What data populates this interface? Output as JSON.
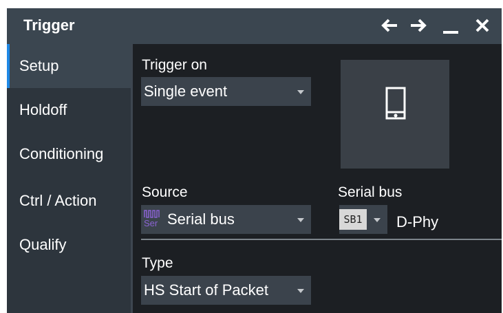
{
  "dialog": {
    "title": "Trigger",
    "titlebar_icons": [
      "arrow-left-icon",
      "arrow-right-icon",
      "minimize-icon",
      "close-icon"
    ],
    "accent_color": "#1e88e5"
  },
  "sidebar": {
    "items": [
      {
        "label": "Setup",
        "active": true
      },
      {
        "label": "Holdoff",
        "active": false
      },
      {
        "label": "Conditioning",
        "active": false
      },
      {
        "label": "Ctrl / Action",
        "active": false
      },
      {
        "label": "Qualify",
        "active": false
      }
    ]
  },
  "main": {
    "trigger_on": {
      "label": "Trigger on",
      "value": "Single event"
    },
    "source": {
      "label": "Source",
      "value": "Serial bus",
      "icon_text": "Ser",
      "icon": "serial-bus-icon"
    },
    "serial_bus": {
      "label": "Serial bus",
      "badge": "SB1",
      "protocol": "D-Phy"
    },
    "type": {
      "label": "Type",
      "value": "HS Start of Packet"
    },
    "preview_icon": "device-phone-icon"
  }
}
